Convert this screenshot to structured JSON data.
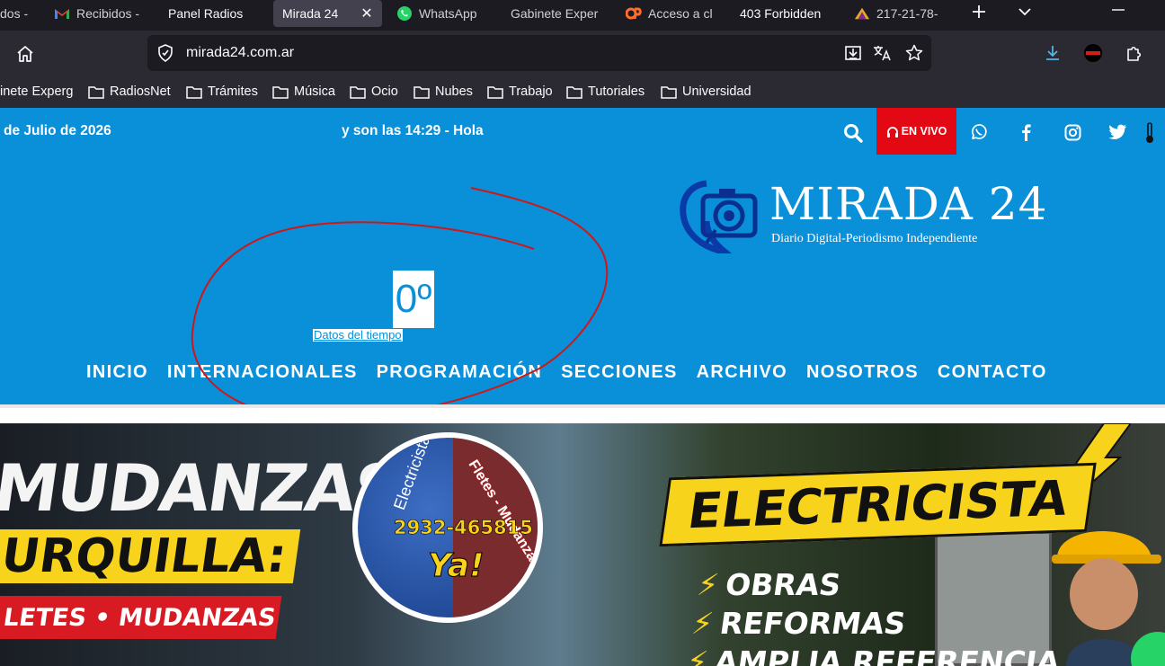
{
  "tabs": [
    {
      "label": "dos -",
      "icon": "none"
    },
    {
      "label": "Recibidos -",
      "icon": "gmail-icon"
    },
    {
      "label": "Panel Radios",
      "icon": "none"
    },
    {
      "label": "Mirada 24",
      "icon": "none",
      "active": true
    },
    {
      "label": "WhatsApp",
      "icon": "whatsapp-icon"
    },
    {
      "label": "Gabinete Exper",
      "icon": "none"
    },
    {
      "label": "Acceso a cl",
      "icon": "cpanel-icon"
    },
    {
      "label": "403 Forbidden",
      "icon": "none"
    },
    {
      "label": "217-21-78-",
      "icon": "server-icon"
    }
  ],
  "tab_close_glyph": "✕",
  "browser": {
    "url": "mirada24.com.ar",
    "accent": "#42414d"
  },
  "bookmarks": [
    {
      "label": "inete Experg",
      "folder": false
    },
    {
      "label": "RadiosNet",
      "folder": true
    },
    {
      "label": "Trámites",
      "folder": true
    },
    {
      "label": "Música",
      "folder": true
    },
    {
      "label": "Ocio",
      "folder": true
    },
    {
      "label": "Nubes",
      "folder": true
    },
    {
      "label": "Trabajo",
      "folder": true
    },
    {
      "label": "Tutoriales",
      "folder": true
    },
    {
      "label": "Universidad",
      "folder": true
    }
  ],
  "site": {
    "date_text": "de Julio de 2026",
    "ticker_text": "y son las 14:29 - Hola",
    "live_label": "EN VIVO",
    "logo_title": "MIRADA 24",
    "logo_subtitle": "Diario Digital-Periodismo Independiente",
    "weather_temp": "0º",
    "weather_label": "Datos del tiempo",
    "brand_color": "#0a8fd9",
    "live_color": "#e20914",
    "nav": [
      "INICIO",
      "INTERNACIONALES",
      "PROGRAMACIÓN",
      "SECCIONES",
      "ARCHIVO",
      "NOSOTROS",
      "CONTACTO"
    ]
  },
  "banner": {
    "left_title": "MUDANZAS",
    "left_subtitle": "URQUILLA:",
    "left_band": "LETES • MUDANZAS",
    "circle_arc_left": "Electricista",
    "circle_arc_right": "Fletes - Mudanzas",
    "circle_phone": "2932-465815",
    "circle_ya": "Ya!",
    "right_title": "ELECTRICISTA",
    "right_items": [
      "OBRAS",
      "REFORMAS",
      "AMPLIA REFERENCIA"
    ],
    "bullet_glyph": "⚡"
  }
}
